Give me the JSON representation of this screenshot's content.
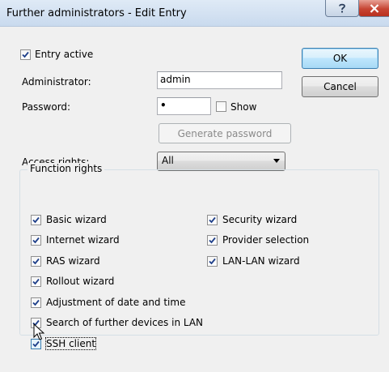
{
  "window": {
    "title": "Further administrators - Edit Entry",
    "help_icon": "question-mark-icon",
    "close_icon": "close-icon"
  },
  "form": {
    "entry_active_label": "Entry active",
    "entry_active_checked": true,
    "administrator_label": "Administrator:",
    "administrator_value": "admin",
    "password_label": "Password:",
    "password_value": "•",
    "show_label": "Show",
    "show_checked": false,
    "generate_password_label": "Generate password",
    "access_rights_label": "Access rights:",
    "access_rights_value": "All"
  },
  "buttons": {
    "ok": "OK",
    "cancel": "Cancel"
  },
  "function_rights": {
    "title": "Function rights",
    "left": [
      {
        "label": "Basic wizard",
        "checked": true
      },
      {
        "label": "Internet wizard",
        "checked": true
      },
      {
        "label": "RAS wizard",
        "checked": true
      },
      {
        "label": "Rollout wizard",
        "checked": true
      },
      {
        "label": "Adjustment of date and time",
        "checked": true
      },
      {
        "label": "Search of further devices in LAN",
        "checked": true
      },
      {
        "label": "SSH client",
        "checked": true
      }
    ],
    "right": [
      {
        "label": "Security wizard",
        "checked": true
      },
      {
        "label": "Provider selection",
        "checked": true
      },
      {
        "label": "LAN-LAN wizard",
        "checked": true
      }
    ]
  }
}
